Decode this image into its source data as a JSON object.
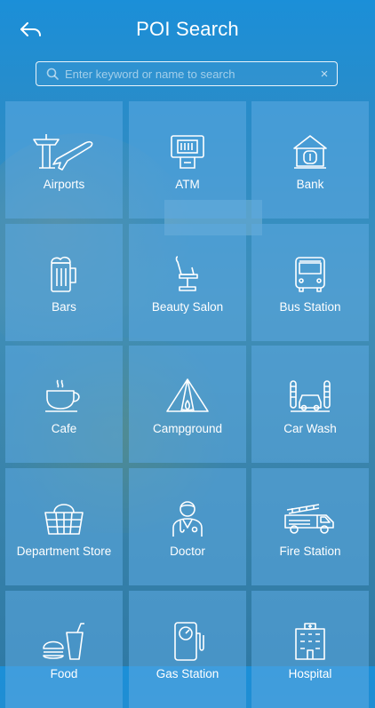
{
  "header": {
    "title": "POI Search"
  },
  "search": {
    "placeholder": "Enter keyword or name to search",
    "value": "",
    "clear_icon": "×"
  },
  "tiles": [
    {
      "label": "Airports",
      "icon": "airport-icon"
    },
    {
      "label": "ATM",
      "icon": "atm-icon"
    },
    {
      "label": "Bank",
      "icon": "bank-icon"
    },
    {
      "label": "Bars",
      "icon": "beer-icon"
    },
    {
      "label": "Beauty Salon",
      "icon": "salon-chair-icon"
    },
    {
      "label": "Bus Station",
      "icon": "bus-icon"
    },
    {
      "label": "Cafe",
      "icon": "coffee-cup-icon"
    },
    {
      "label": "Campground",
      "icon": "tent-icon"
    },
    {
      "label": "Car Wash",
      "icon": "car-wash-icon"
    },
    {
      "label": "Department Store",
      "icon": "basket-icon"
    },
    {
      "label": "Doctor",
      "icon": "doctor-icon"
    },
    {
      "label": "Fire Station",
      "icon": "fire-truck-icon"
    },
    {
      "label": "Food",
      "icon": "food-icon"
    },
    {
      "label": "Gas Station",
      "icon": "gas-pump-icon"
    },
    {
      "label": "Hospital",
      "icon": "hospital-icon"
    }
  ],
  "colors": {
    "background": "#2a8cc8",
    "tile": "#5caae1",
    "text": "#ffffff"
  }
}
